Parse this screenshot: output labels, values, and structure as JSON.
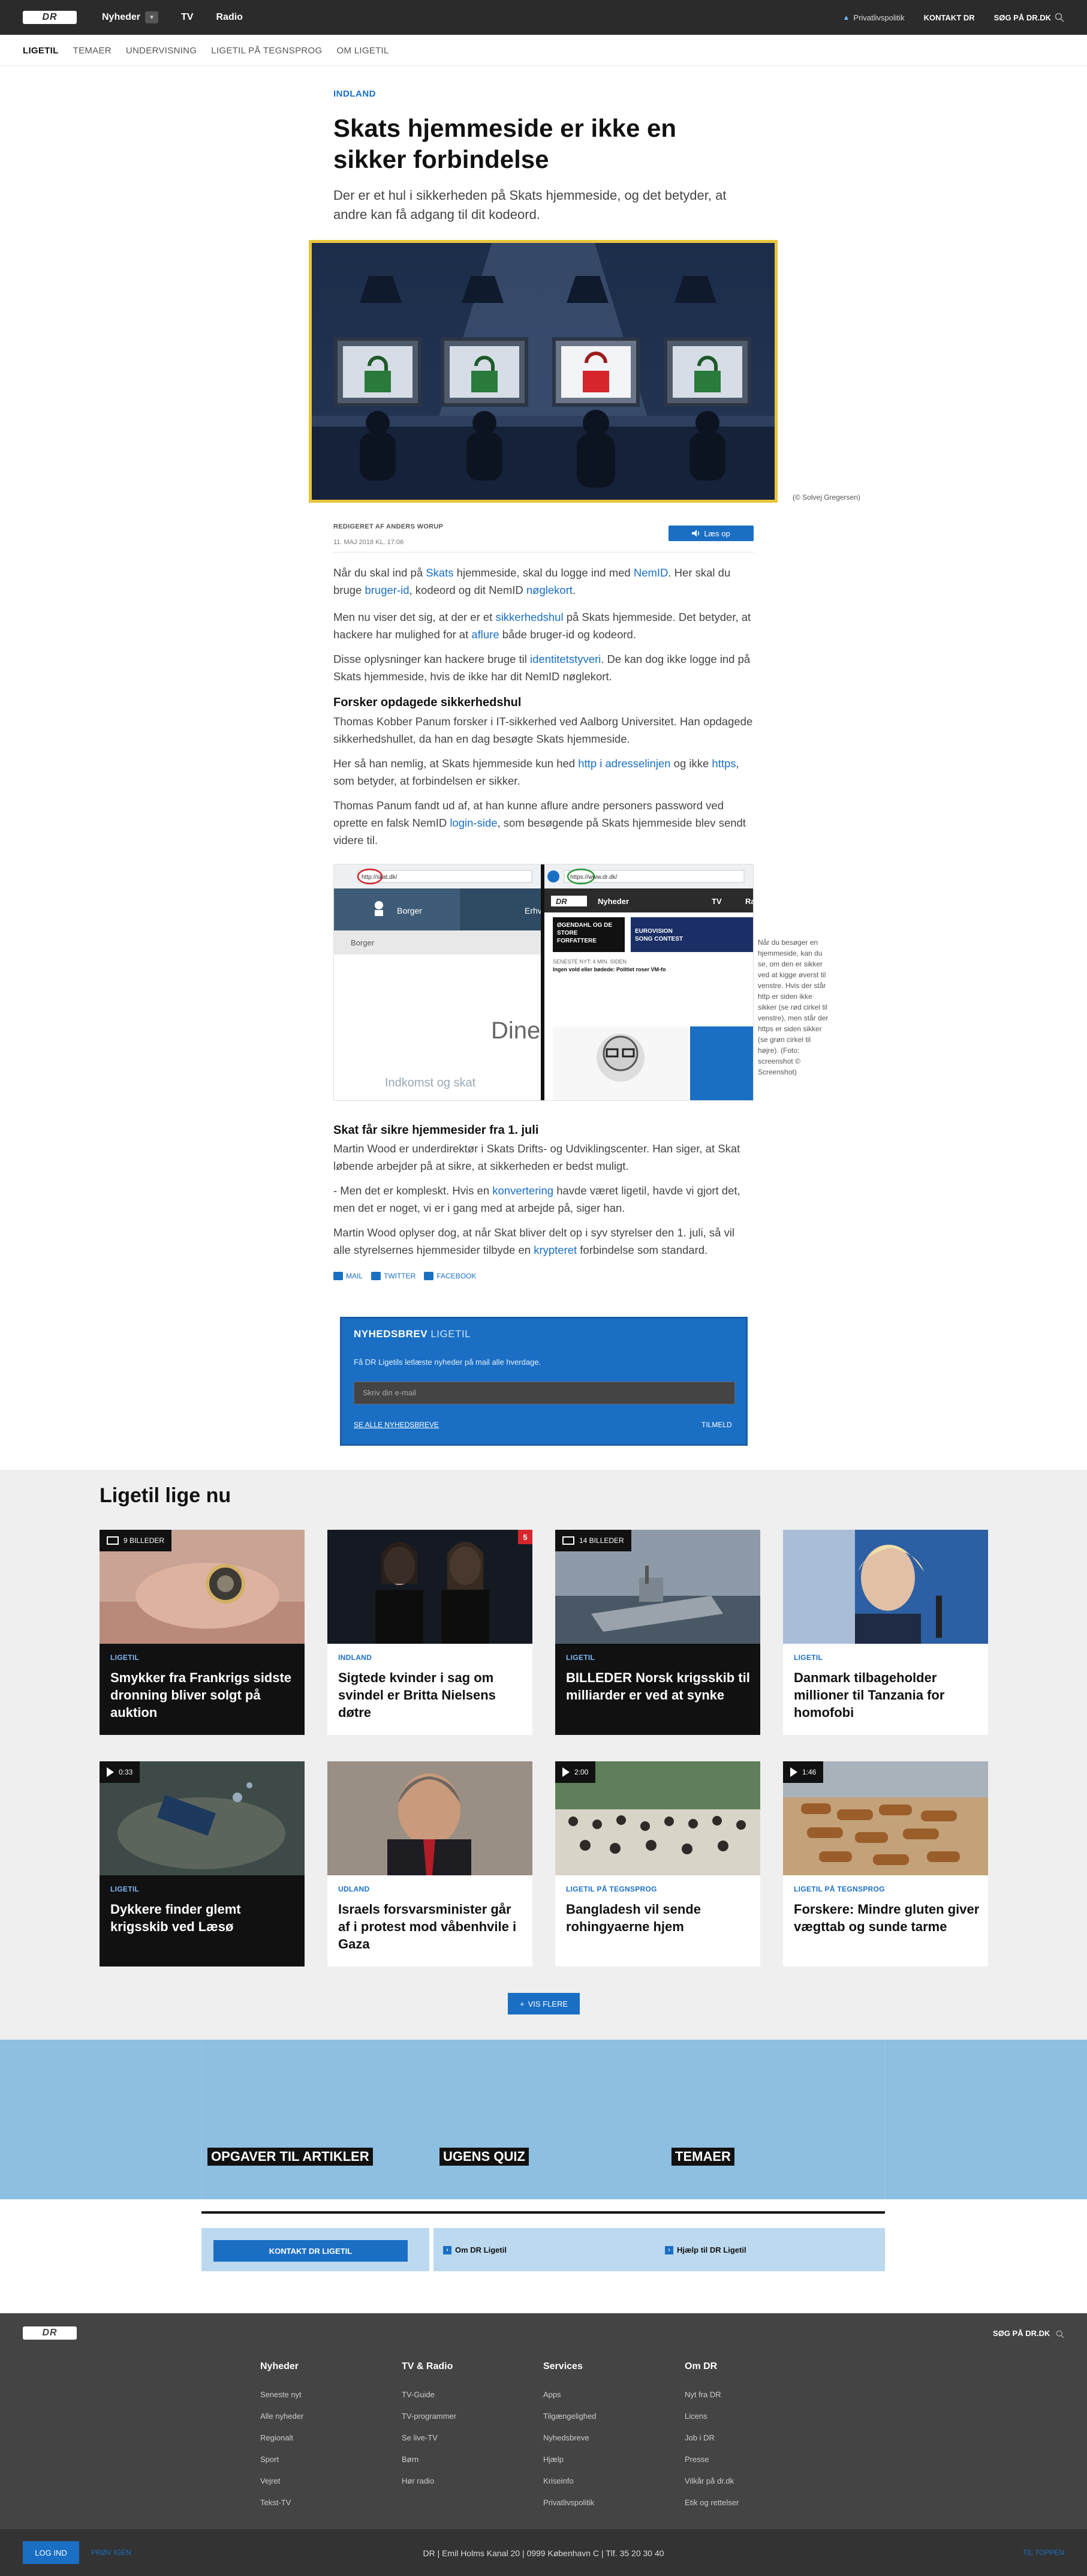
{
  "topbar": {
    "logo": "DR",
    "nav": [
      "Nyheder",
      "TV",
      "Radio"
    ],
    "privacy": "Privatlivspolitik",
    "contact": "KONTAKT DR",
    "search": "SØG PÅ DR.DK"
  },
  "subnav": [
    "LIGETIL",
    "TEMAER",
    "UNDERVISNING",
    "LIGETIL PÅ TEGNSPROG",
    "OM LIGETIL"
  ],
  "article": {
    "category": "INDLAND",
    "headline": "Skats hjemmeside er ikke en sikker forbindelse",
    "lead": "Der er et hul i sikkerheden på Skats hjemmeside, og det betyder, at andre kan få adgang til dit kodeord.",
    "image_credit": "(© Solvej Gregersen)",
    "byline": "REDIGERET AF ANDERS WORUP",
    "date": "11. MAJ 2018 KL. 17:06",
    "listen": "Læs op",
    "p1": [
      "Når du skal ind på ",
      "Skats",
      " hjemmeside, skal du logge ind med ",
      "NemID",
      ". Her skal du bruge ",
      "bruger-id",
      ", kodeord og dit NemID ",
      "nøglekort",
      "."
    ],
    "p2": [
      "Men nu viser det sig, at der er et ",
      "sikkerhedshul",
      " på Skats hjemmeside. Det betyder, at hackere har mulighed for at ",
      "aflure",
      " både bruger-id og kodeord."
    ],
    "p3": [
      "Disse oplysninger kan hackere bruge til ",
      "identitetstyveri",
      ". De kan dog ikke logge ind på Skats hjemmeside, hvis de ikke har dit NemID nøglekort."
    ],
    "sub1": "Forsker opdagede sikkerhedshul",
    "p4": "Thomas Kobber Panum forsker i IT-sikkerhed ved Aalborg Universitet. Han opdagede sikkerhedshullet, da han en dag besøgte Skats hjemmeside.",
    "p5": [
      "Her så han nemlig, at Skats hjemmeside kun hed ",
      "http i adresselinjen",
      " og ikke ",
      "https",
      ", som betyder, at forbindelsen er sikker."
    ],
    "p6": [
      "Thomas Panum fandt ud af, at han kunne aflure andre personers password ved oprette en falsk NemID ",
      "login-side",
      ", som besøgende på Skats hjemmeside blev sendt videre til."
    ],
    "shot_caption": "Når du besøger en hjemmeside, kan du se, om den er sikker ved at kigge øverst til venstre. Hvis der står http er siden ikke sikker (se rød cirkel til venstre), men står der https er siden sikker (se grøn cirkel til højre). (Foto: screenshot © Screenshot)",
    "shot": {
      "left_url": "http://skat.dk/",
      "right_url": "https://www.dr.dk/",
      "borger": "Borger",
      "erhv": "Erhv",
      "din": "Dine",
      "indkomst": "Indkomst og skat",
      "dr_nav": [
        "Nyheder",
        "TV",
        "Ra"
      ],
      "headline1": "ØGENDAHL OG DE STORE FORFATTERE",
      "headline2": "EUROVISION SONG CONTEST",
      "meta": "SENESTE NYT: 4 MIN. SIDEN",
      "teaser": "Ingen vold eller bødede: Politiet roser VM-fo"
    },
    "sub2": "Skat får sikre hjemmesider fra 1. juli",
    "p7": "Martin Wood er underdirektør i Skats Drifts- og Udviklingscenter. Han siger, at Skat løbende arbejder på at sikre, at sikkerheden er bedst muligt.",
    "p8": [
      "- Men det er kompleskt. Hvis en ",
      "konvertering",
      " havde været ligetil, havde vi gjort det, men det er noget, vi er i gang med at arbejde på, siger han."
    ],
    "p9": [
      "Martin Wood oplyser dog, at når Skat bliver delt op i syv styrelser den 1. juli, så vil alle styrelsernes hjemmesider tilbyde en ",
      "krypteret",
      " forbindelse som standard."
    ],
    "share": [
      "MAIL",
      "TWITTER",
      "FACEBOOK"
    ]
  },
  "newsletter": {
    "title_bold": "NYHEDSBREV",
    "title_light": "LIGETIL",
    "desc": "Få DR Ligetils letlæste nyheder på mail alle hverdage.",
    "placeholder": "Skriv din e-mail",
    "all": "SE ALLE NYHEDSBREVE",
    "subscribe": "TILMELD"
  },
  "section_title": "Ligetil lige nu",
  "cards": [
    {
      "tag": "LIGETIL",
      "title": "Smykker fra Frankrigs sidste dronning bliver solgt på auktion",
      "badge": "9 BILLEDER",
      "badge_type": "gallery",
      "dark": true
    },
    {
      "tag": "INDLAND",
      "title": "Sigtede kvinder i sag om svindel er Britta Nielsens døtre",
      "badge": "",
      "badge_type": "",
      "dark": false,
      "red_badge": "5"
    },
    {
      "tag": "LIGETIL",
      "title": "BILLEDER Norsk krigsskib til milliarder er ved at synke",
      "badge": "14 BILLEDER",
      "badge_type": "gallery",
      "dark": true
    },
    {
      "tag": "LIGETIL",
      "title": "Danmark tilbageholder millioner til Tanzania for homofobi",
      "badge": "",
      "badge_type": "",
      "dark": false
    },
    {
      "tag": "LIGETIL",
      "title": "Dykkere finder glemt krigsskib ved Læsø",
      "badge": "0:33",
      "badge_type": "video",
      "dark": true
    },
    {
      "tag": "UDLAND",
      "title": "Israels forsvarsminister går af i protest mod våbenhvile i Gaza",
      "badge": "",
      "badge_type": "",
      "dark": false
    },
    {
      "tag": "LIGETIL PÅ TEGNSPROG",
      "title": "Bangladesh vil sende rohingyaerne hjem",
      "badge": "2:00",
      "badge_type": "video",
      "dark": false
    },
    {
      "tag": "LIGETIL PÅ TEGNSPROG",
      "title": "Forskere: Mindre gluten giver vægttab og sunde tarme",
      "badge": "1:46",
      "badge_type": "video",
      "dark": false
    }
  ],
  "more_button": "VIS FLERE",
  "promos": [
    "OPGAVER TIL ARTIKLER",
    "UGENS QUIZ",
    "TEMAER"
  ],
  "contact_btn": "KONTAKT DR LIGETIL",
  "links": [
    "Om DR Ligetil",
    "Hjælp til DR Ligetil"
  ],
  "footer": {
    "logo": "DR",
    "search": "SØG PÅ DR.DK",
    "cols": [
      {
        "h": "Nyheder",
        "items": [
          "Seneste nyt",
          "Alle nyheder",
          "Regionalt",
          "Sport",
          "Vejret",
          "Tekst-TV"
        ]
      },
      {
        "h": "TV & Radio",
        "items": [
          "TV-Guide",
          "TV-programmer",
          "Se live-TV",
          "Børn",
          "Hør radio"
        ]
      },
      {
        "h": "Services",
        "items": [
          "Apps",
          "Tilgængelighed",
          "Nyhedsbreve",
          "Hjælp",
          "Kriseinfo",
          "Privatlivspolitik"
        ]
      },
      {
        "h": "Om DR",
        "items": [
          "Nyt fra DR",
          "Licens",
          "Job i DR",
          "Presse",
          "Vilkår på dr.dk",
          "Etik og rettelser"
        ]
      }
    ],
    "login": "LOG IND",
    "tryagain": "PRØV IGEN",
    "address": "DR   |   Emil Holms Kanal 20   |   0999 København C   |   Tlf. 35 20 30 40",
    "totop": "TIL TOPPEN"
  },
  "colors": {
    "accent": "#1a6fc4",
    "topbar": "#2b2b2b",
    "hero_border": "#e8c43a",
    "band": "#8dbfe1"
  }
}
